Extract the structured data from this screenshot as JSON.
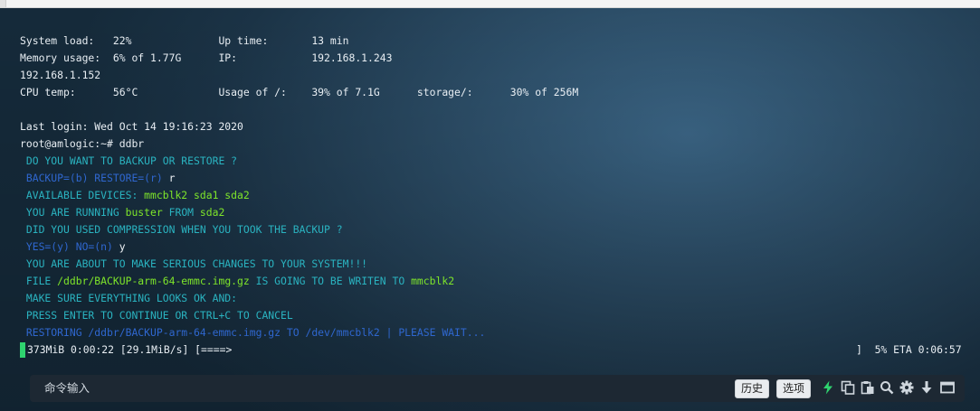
{
  "terminal": {
    "lines": {
      "l1": "System load:   22%              Up time:       13 min",
      "l2": "Memory usage:  6% of 1.77G      IP:            192.168.1.243",
      "l3": "192.168.1.152",
      "l4": "CPU temp:      56°C             Usage of /:    39% of 7.1G      storage/:      30% of 256M",
      "l5": "Last login: Wed Oct 14 19:16:23 2020",
      "l6": "root@amlogic:~# ddbr",
      "l7": " DO YOU WANT TO BACKUP OR RESTORE ?",
      "l8a": " BACKUP=(b) RESTORE=(r) ",
      "l8b": "r",
      "l9a": " AVAILABLE DEVICES: ",
      "l9b": "mmcblk2 sda1 sda2",
      "l10a": " YOU ARE RUNNING ",
      "l10b": "buster",
      "l10c": " FROM ",
      "l10d": "sda2",
      "l11": " DID YOU USED COMPRESSION WHEN YOU TOOK THE BACKUP ?",
      "l12a": " YES=(y) NO=(n) ",
      "l12b": "y",
      "l13": " YOU ARE ABOUT TO MAKE SERIOUS CHANGES TO YOUR SYSTEM!!!",
      "l14a": " FILE ",
      "l14b": "/ddbr/BACKUP-arm-64-emmc.img.gz",
      "l14c": " IS GOING TO BE WRITEN TO ",
      "l14d": "mmcblk2",
      "l15": " MAKE SURE EVERYTHING LOOKS OK AND:",
      "l16": " PRESS ENTER TO CONTINUE OR CTRL+C TO CANCEL",
      "l17": " RESTORING /ddbr/BACKUP-arm-64-emmc.img.gz TO /dev/mmcblk2 | PLEASE WAIT...",
      "l18a": "373MiB 0:00:22 [29.1MiB/s] [====>",
      "l18b": "]  5% ETA 0:06:57"
    }
  },
  "command_bar": {
    "placeholder": "命令输入",
    "history_label": "历史",
    "options_label": "选项"
  },
  "icons": [
    "lightning-icon",
    "copy-icon",
    "paste-icon",
    "search-icon",
    "gear-icon",
    "download-arrow-icon",
    "window-icon"
  ],
  "colors": {
    "cyan_text": "#2ab3c0",
    "blue_text": "#2f67cf",
    "green_text": "#7ee52a",
    "cursor": "#2fd36f",
    "lightning": "#2fd36f"
  }
}
